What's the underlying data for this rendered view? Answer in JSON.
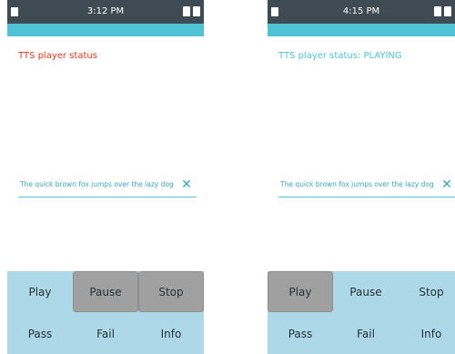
{
  "screens": [
    {
      "status_bar": {
        "time": "3:12 PM"
      },
      "tts_status": "TTS player status",
      "tts_input": {
        "value": "The quick brown fox jumps over the lazy dog"
      },
      "buttons": {
        "play": "Play",
        "pause": "Pause",
        "stop": "Stop",
        "pass": "Pass",
        "fail": "Fail",
        "info": "Info"
      },
      "active_buttons": [
        "Pause",
        "Stop"
      ]
    },
    {
      "status_bar": {
        "time": "4:15 PM"
      },
      "tts_status": "TTS player status: PLAYING",
      "tts_input": {
        "value": "The quick brown fox jumps over the lazy dog"
      },
      "buttons": {
        "play": "Play",
        "pause": "Pause",
        "stop": "Stop",
        "pass": "Pass",
        "fail": "Fail",
        "info": "Info"
      },
      "active_buttons": [
        "Play"
      ]
    }
  ],
  "colors": {
    "status_bar": "#3f4b52",
    "accent": "#4fc3d3",
    "status_error": "#e4361e",
    "button_panel": "#add8e8",
    "button_active": "#a0a0a0"
  },
  "icons": {
    "clear": "close-icon",
    "status_left": "notification-icon",
    "status_right": "battery-icon"
  }
}
